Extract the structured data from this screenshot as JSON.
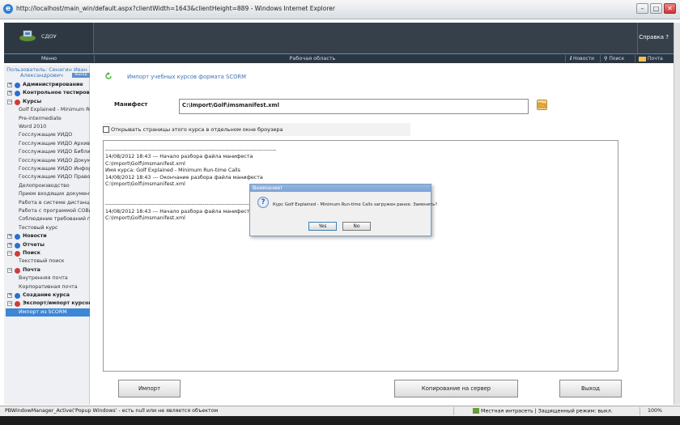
{
  "window": {
    "title": "http://localhost/main_win/default.aspx?clientWidth=1643&clientHeight=889 - Windows Internet Explorer",
    "minimize": "–",
    "maximize": "□",
    "close": "✕"
  },
  "header": {
    "logo_text": "СДОУ",
    "logo_suffix": "",
    "help": "Справка ?"
  },
  "toolbar": {
    "menu": "Меню",
    "workarea": "Рабочая область",
    "news": "Новости",
    "search": "Поиск",
    "mail": "Почта"
  },
  "sidebar": {
    "user_line1": "Пользователь: Сенагин Иван",
    "user_line2": "Александрович",
    "exit": "Выход",
    "items": [
      {
        "label": "Администрирование",
        "level": 0,
        "sign": "+",
        "icon_color": "#2b6fcf"
      },
      {
        "label": "Контрольное тестирование",
        "level": 0,
        "sign": "+",
        "icon_color": "#2b6fcf"
      },
      {
        "label": "Курсы",
        "level": 0,
        "sign": "−",
        "icon_color": "#d23a3a"
      },
      {
        "label": "Golf Explained - Minimum Run-ti",
        "level": 1
      },
      {
        "label": "Pre-intermediate",
        "level": 1
      },
      {
        "label": "Word 2010",
        "level": 1
      },
      {
        "label": "Госслужащие УИДО",
        "level": 1
      },
      {
        "label": "Госслужащие УИДО Архив",
        "level": 1
      },
      {
        "label": "Госслужащие УИДО Библиотек",
        "level": 1
      },
      {
        "label": "Госслужащие УИДО Документ",
        "level": 1
      },
      {
        "label": "Госслужащие УИДО Информа",
        "level": 1
      },
      {
        "label": "Госслужащие УИДО Правовой",
        "level": 1
      },
      {
        "label": "Делопроизводство",
        "level": 1
      },
      {
        "label": "Прием входящих документов",
        "level": 1
      },
      {
        "label": "Работа в системе дистанцион",
        "level": 1
      },
      {
        "label": "Работа с программой СОВитт",
        "level": 1
      },
      {
        "label": "Соблюдение требований по н",
        "level": 1
      },
      {
        "label": "Тестовый курс",
        "level": 1
      },
      {
        "label": "Новости",
        "level": 0,
        "sign": "+",
        "icon_color": "#2b6fcf"
      },
      {
        "label": "Отчеты",
        "level": 0,
        "sign": "+",
        "icon_color": "#2b6fcf"
      },
      {
        "label": "Поиск",
        "level": 0,
        "sign": "−",
        "icon_color": "#d23a3a"
      },
      {
        "label": "Текстовый поиск",
        "level": 1
      },
      {
        "label": "Почта",
        "level": 0,
        "sign": "−",
        "icon_color": "#d23a3a"
      },
      {
        "label": "Внутренняя почта",
        "level": 1
      },
      {
        "label": "Корпоративная почта",
        "level": 1
      },
      {
        "label": "Создание курса",
        "level": 0,
        "sign": "+",
        "icon_color": "#2b6fcf"
      },
      {
        "label": "Экспорт/импорт курсов",
        "level": 0,
        "sign": "−",
        "icon_color": "#d23a3a"
      },
      {
        "label": "Импорт из SCORM",
        "level": 1,
        "active": true
      }
    ]
  },
  "main": {
    "title": "Импорт учебных курсов формата SCORM",
    "manifest_label": "Манифест",
    "manifest_value": "C:\\Import\\Golf\\imsmanifest.xml",
    "open_in_new_window": "Открывать страницы этого курса в отдельном окне броузера",
    "log_lines": [
      "---------------------------------------------------------------------------------------------",
      "14/08/2012 18:43 ---   Начало разбора файла манифеста",
      "C:\\Import\\Golf\\imsmanifest.xml",
      "Имя курса:  Golf Explained - Minimum Run-time Calls",
      "14/08/2012 18:43 ---   Окончание  разбора файла манифеста",
      "C:\\Import\\Golf\\imsmanifest.xml",
      "",
      "",
      "---------------------------------------------------------------------------------------------",
      "14/08/2012 18:43 ---   Начало разбора файла манифеста",
      "C:\\Import\\Golf\\imsmanifest.xml"
    ],
    "buttons": {
      "import": "Импорт",
      "copy": "Копирование на сервер",
      "exit": "Выход"
    }
  },
  "dialog": {
    "title": "Внимание!",
    "message": "Курс Golf Explained - Minimum Run-time Calls загружен ранее. Заменить?",
    "yes": "Yes",
    "no": "No"
  },
  "status": {
    "text": "PBWindowManager_Active('Popup Windows' - есть null или не является объектом",
    "zone": "Местная интрасеть | Защищенный режим: выкл.",
    "zoom": "100%"
  }
}
